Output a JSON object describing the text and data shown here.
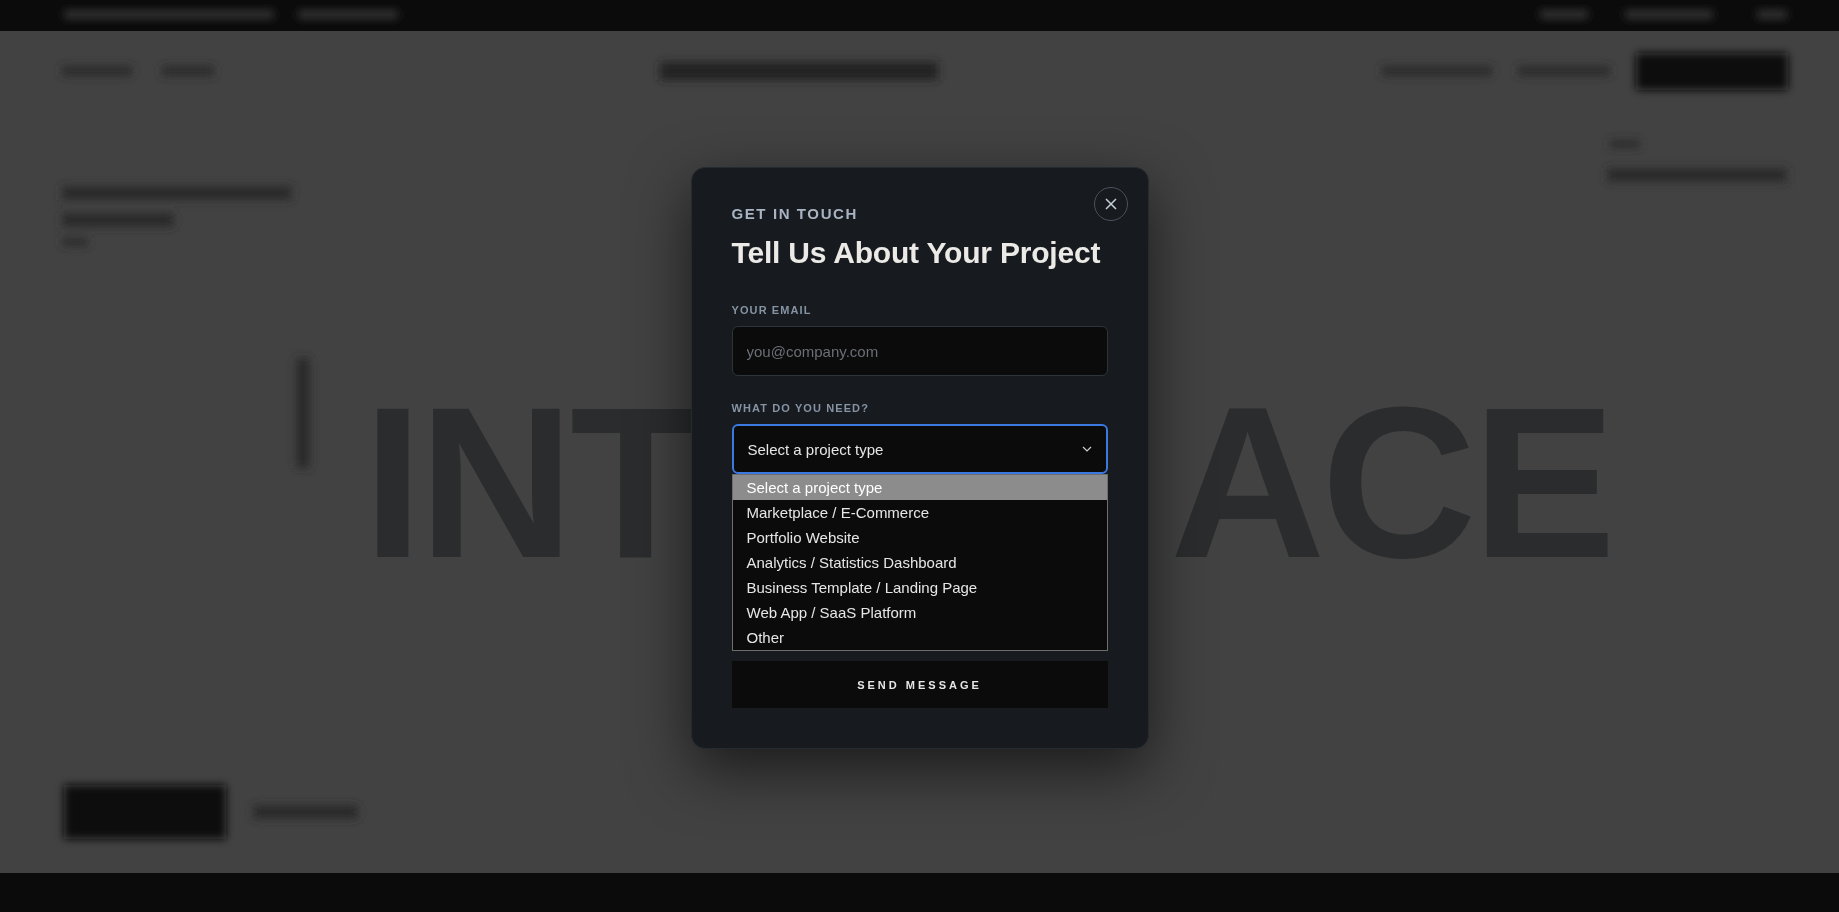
{
  "backdrop": {
    "headline_fragments": [
      "INT",
      "ACE"
    ]
  },
  "modal": {
    "eyebrow": "GET IN TOUCH",
    "title": "Tell Us About Your Project",
    "email": {
      "label": "YOUR EMAIL",
      "placeholder": "you@company.com"
    },
    "project_type": {
      "label": "WHAT DO YOU NEED?",
      "value": "Select a project type",
      "expanded": true,
      "options": [
        {
          "label": "Select a project type",
          "selected": true
        },
        {
          "label": "Marketplace / E-Commerce",
          "selected": false
        },
        {
          "label": "Portfolio Website",
          "selected": false
        },
        {
          "label": "Analytics / Statistics Dashboard",
          "selected": false
        },
        {
          "label": "Business Template / Landing Page",
          "selected": false
        },
        {
          "label": "Web App / SaaS Platform",
          "selected": false
        },
        {
          "label": "Other",
          "selected": false
        }
      ]
    },
    "submit": "SEND MESSAGE"
  }
}
